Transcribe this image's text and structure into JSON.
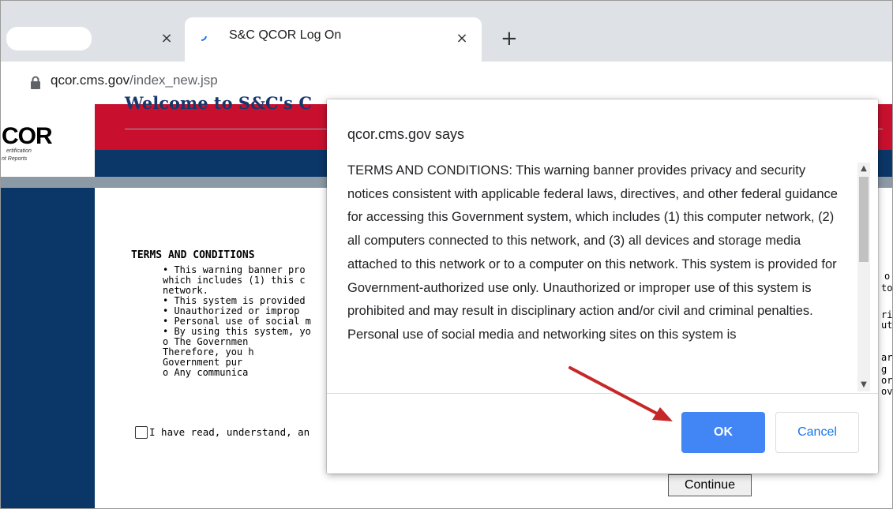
{
  "browser": {
    "tab_active_title": "S&C QCOR Log On",
    "tab_close_glyph": "×",
    "new_tab_glyph": "+",
    "url_host": "qcor.cms.gov",
    "url_path": "/index_new.jsp"
  },
  "page": {
    "logo_big": "COR",
    "logo_line1": "ertification",
    "logo_line2": "nt Reports",
    "welcome_heading": "Welcome to S&C's C",
    "terms_heading": "TERMS AND CONDITIONS",
    "terms_lines": [
      "•  This warning banner pro",
      "   which includes (1) this c",
      "   network.",
      "•  This system is provided",
      "•  Unauthorized or improp",
      "•  Personal use of social m",
      "•  By using this system, yo",
      "      o  The Governmen",
      "         Therefore, you h",
      "         Government pur",
      "      o  Any communica"
    ],
    "right_fragments": [
      "o",
      "to",
      "rir",
      "ut",
      "ar",
      "g c",
      "or",
      "ov"
    ],
    "checkbox_label": "I have read, understand, an",
    "continue_label": "Continue"
  },
  "dialog": {
    "title": "qcor.cms.gov says",
    "message": "TERMS AND CONDITIONS: This warning banner provides privacy and security notices consistent with applicable federal laws, directives, and other federal guidance for accessing this Government system, which includes (1) this computer network, (2) all computers connected to this network, and (3) all devices and storage media attached to this network or to a computer on this network. This system is provided for Government-authorized use only. Unauthorized or improper use of this system is prohibited and may result in disciplinary action and/or civil and criminal penalties. Personal use of social media and networking sites on this system is",
    "ok_label": "OK",
    "cancel_label": "Cancel",
    "scroll_up_glyph": "▲",
    "scroll_down_glyph": "▼"
  },
  "colors": {
    "header_red": "#c8102e",
    "header_navy": "#0b3668",
    "ok_blue": "#4285f4",
    "arrow_red": "#c62828"
  }
}
